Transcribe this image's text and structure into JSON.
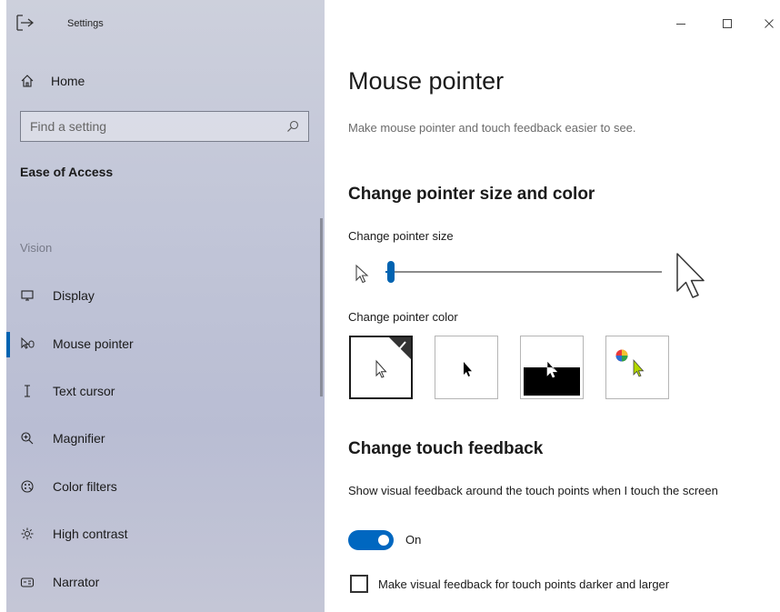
{
  "window": {
    "title": "Settings",
    "controls": {
      "minimize": "–",
      "maximize": "☐",
      "close": "✕"
    }
  },
  "sidebar": {
    "home_label": "Home",
    "search_placeholder": "Find a setting",
    "section_title": "Ease of Access",
    "group_label": "Vision",
    "items": [
      {
        "label": "Display",
        "icon": "monitor-icon"
      },
      {
        "label": "Mouse pointer",
        "icon": "mouse-pointer-icon",
        "selected": true
      },
      {
        "label": "Text cursor",
        "icon": "text-cursor-icon"
      },
      {
        "label": "Magnifier",
        "icon": "magnifier-icon"
      },
      {
        "label": "Color filters",
        "icon": "color-filters-icon"
      },
      {
        "label": "High contrast",
        "icon": "high-contrast-icon"
      },
      {
        "label": "Narrator",
        "icon": "narrator-icon"
      }
    ]
  },
  "main": {
    "title": "Mouse pointer",
    "description": "Make mouse pointer and touch feedback easier to see.",
    "pointer_section": {
      "heading": "Change pointer size and color",
      "size_label": "Change pointer size",
      "size_value_fraction": 0.02,
      "color_label": "Change pointer color",
      "color_options": [
        {
          "name": "white",
          "selected": true
        },
        {
          "name": "black",
          "selected": false
        },
        {
          "name": "inverted",
          "selected": false
        },
        {
          "name": "custom",
          "selected": false
        }
      ]
    },
    "touch_section": {
      "heading": "Change touch feedback",
      "feedback_text": "Show visual feedback around the touch points when I touch the screen",
      "toggle_state": "On",
      "toggle_on": true,
      "checkbox_label": "Make visual feedback for touch points darker and larger",
      "checkbox_checked": false
    }
  },
  "colors": {
    "accent": "#0063b1",
    "sidebar_bg": "#c2c6d8"
  }
}
